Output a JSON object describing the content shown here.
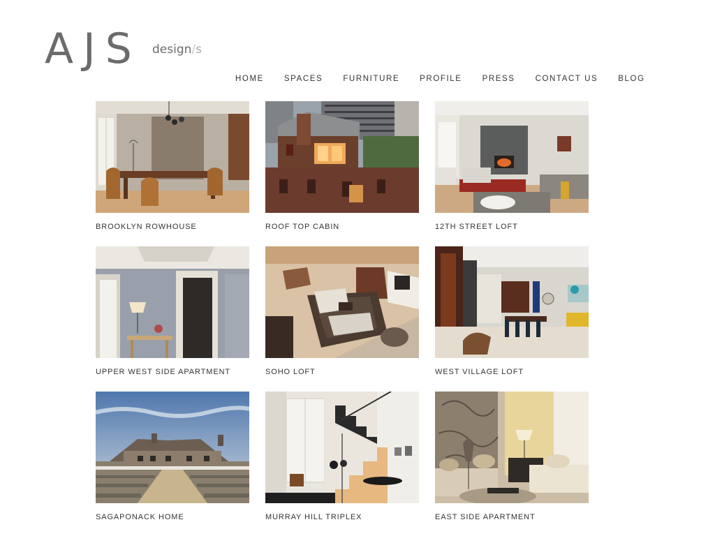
{
  "logo": {
    "main": "AJS",
    "sub": "design",
    "sep": "/",
    "sub2": "s"
  },
  "nav": [
    "HOME",
    "SPACES",
    "FURNITURE",
    "PROFILE",
    "PRESS",
    "CONTACT US",
    "BLOG"
  ],
  "projects": [
    {
      "title": "BROOKLYN ROWHOUSE"
    },
    {
      "title": "ROOF TOP CABIN"
    },
    {
      "title": "12TH STREET LOFT"
    },
    {
      "title": "UPPER WEST SIDE APARTMENT"
    },
    {
      "title": "SOHO LOFT"
    },
    {
      "title": "WEST VILLAGE LOFT"
    },
    {
      "title": "SAGAPONACK HOME"
    },
    {
      "title": "MURRAY HILL TRIPLEX"
    },
    {
      "title": "EAST SIDE APARTMENT"
    }
  ]
}
